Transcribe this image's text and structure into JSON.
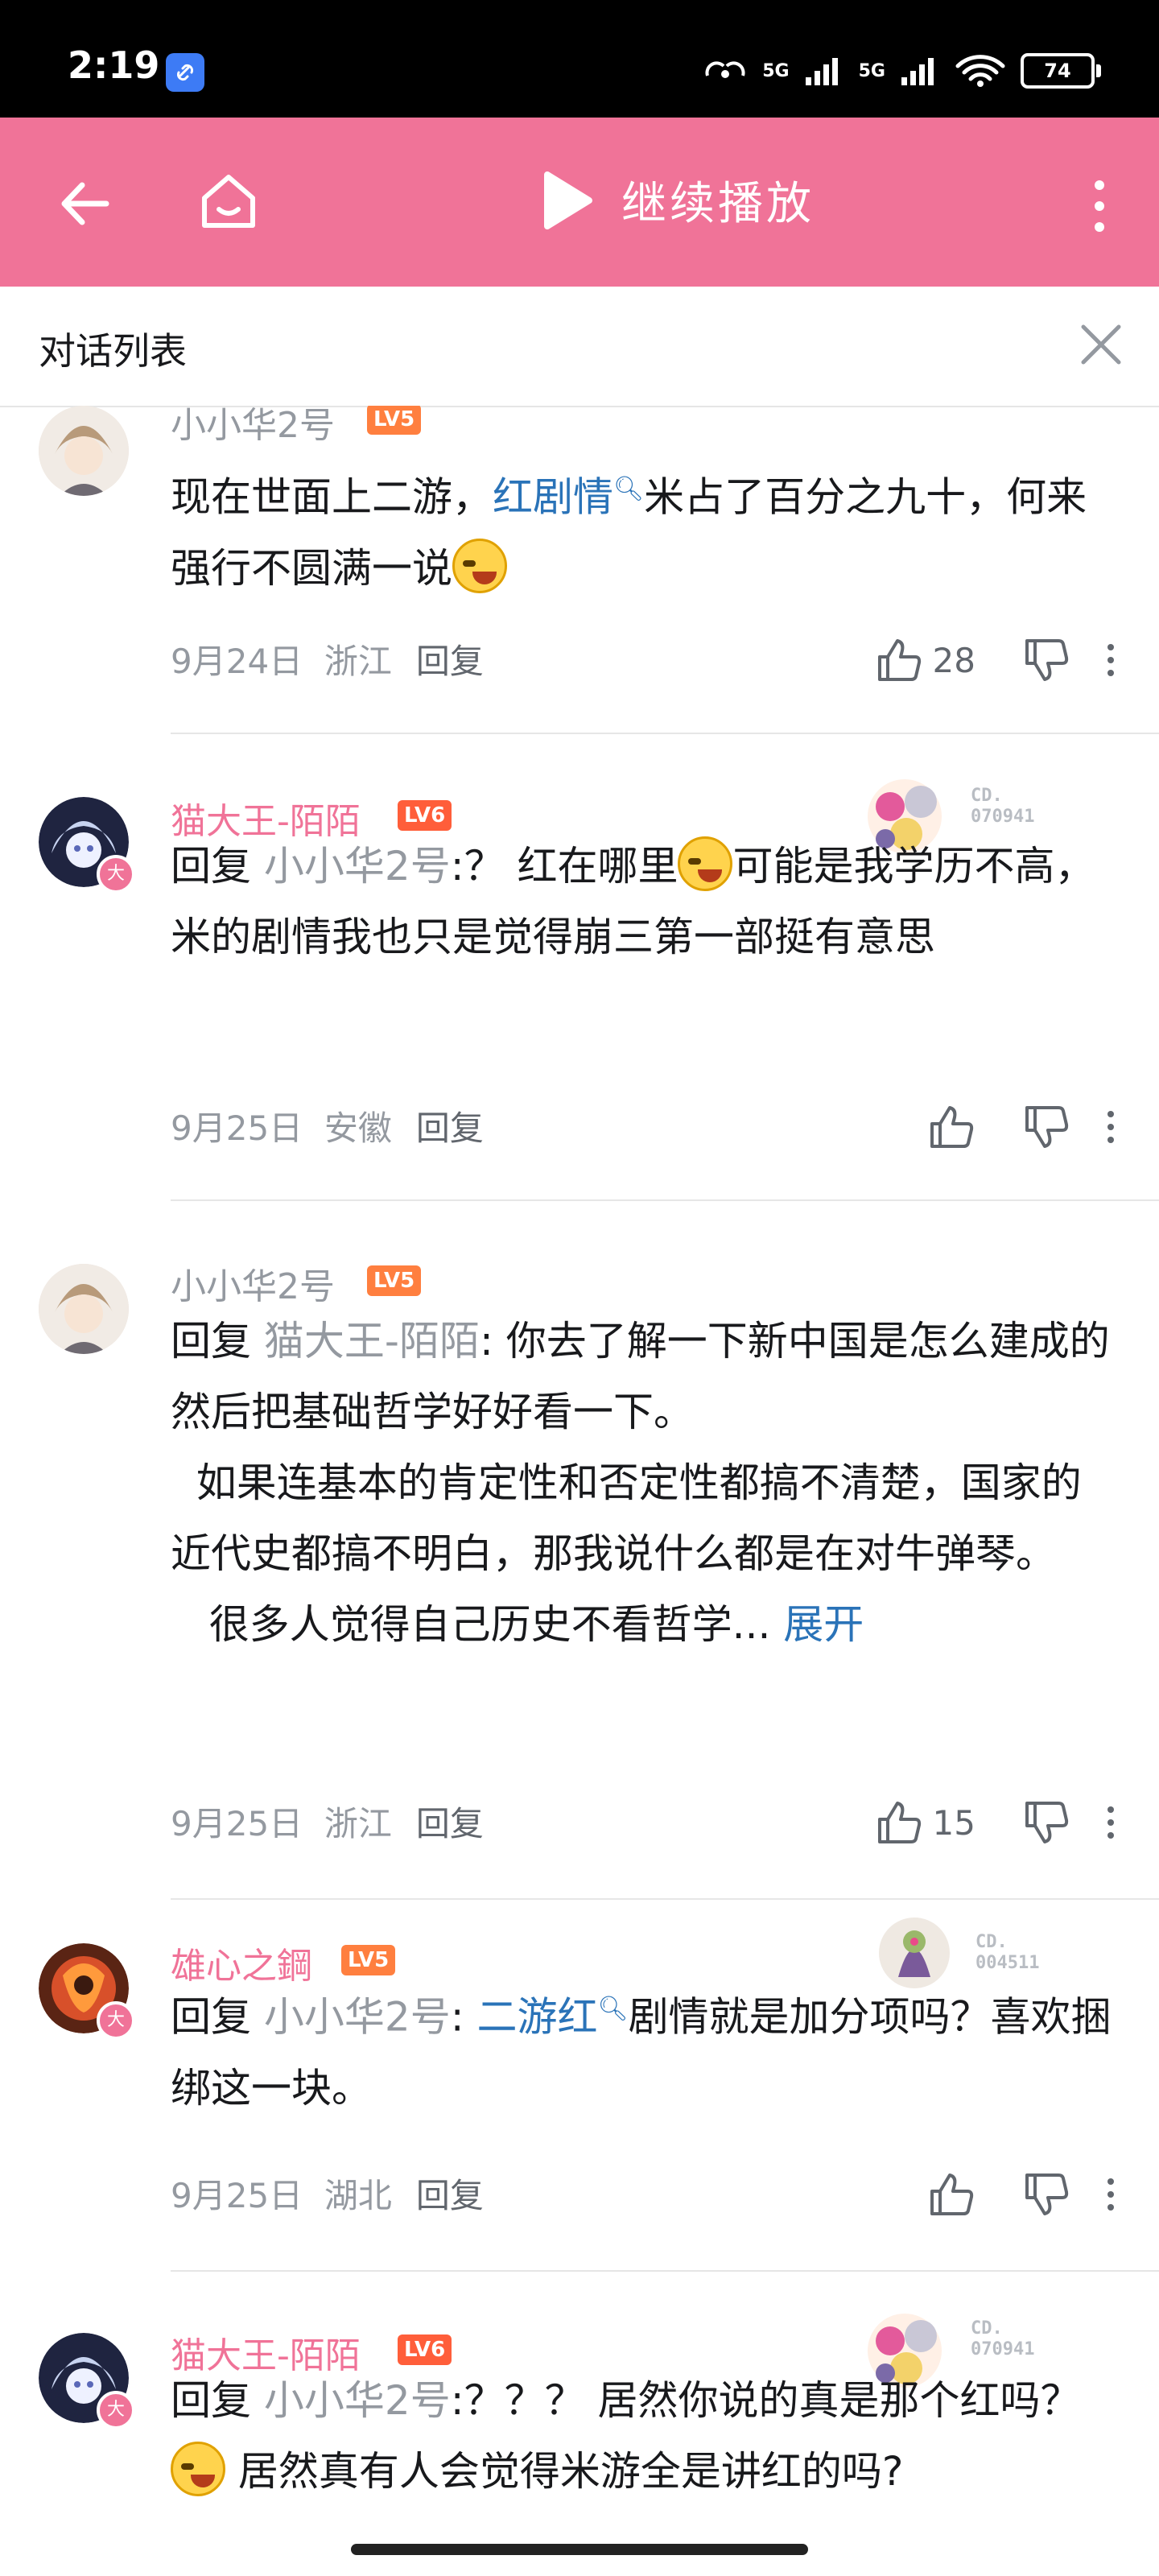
{
  "status_bar": {
    "time": "2:19",
    "net1": "5G",
    "net2": "5G",
    "battery": "74"
  },
  "top_bar": {
    "play_label": "继续播放"
  },
  "panel": {
    "title": "对话列表"
  },
  "comments": [
    {
      "user": "小小华2号",
      "level": "LV5",
      "t1": "现在世面上二游，",
      "link": "红剧情",
      "t2": "米占了百分之九十，何来强行不圆满一说",
      "date": "9月24日",
      "region": "浙江",
      "reply": "回复",
      "likes": "28"
    },
    {
      "user": "猫大王-陌陌",
      "level": "LV6",
      "fan_code_1": "CD.",
      "fan_code_2": "070941",
      "reply_prefix": "回复 ",
      "reply_to": "小小华2号",
      "t1": ":？ 红在哪里",
      "t2": "可能是我学历不高，米的剧情我也只是觉得崩三第一部挺有意思",
      "date": "9月25日",
      "region": "安徽",
      "reply": "回复"
    },
    {
      "user": "小小华2号",
      "level": "LV5",
      "reply_prefix": "回复 ",
      "reply_to": "猫大王-陌陌",
      "t1": ": 你去了解一下新中国是怎么建成的然后把基础哲学好好看一下。",
      "t2": "  如果连基本的肯定性和否定性都搞不清楚，国家的近代史都搞不明白，那我说什么都是在对牛弹琴。",
      "t3": "   很多人觉得自己历史不看哲学...",
      "expand": "展开",
      "date": "9月25日",
      "region": "浙江",
      "reply": "回复",
      "likes": "15"
    },
    {
      "user": "雄心之鋼",
      "level": "LV5",
      "fan_code_1": "CD.",
      "fan_code_2": "004511",
      "reply_prefix": "回复 ",
      "reply_to": "小小华2号",
      "colon": ": ",
      "link": "二游红",
      "t2": "剧情就是加分项吗？喜欢捆绑这一块。",
      "date": "9月25日",
      "region": "湖北",
      "reply": "回复"
    },
    {
      "user": "猫大王-陌陌",
      "level": "LV6",
      "fan_code_1": "CD.",
      "fan_code_2": "070941",
      "reply_prefix": "回复 ",
      "reply_to": "小小华2号",
      "t1": ":？？？ 居然你说的真是那个红吗？",
      "t2": "居然真有人会觉得米游全是讲红的吗?"
    }
  ],
  "avatar_badge": "大",
  "colors": {
    "accent": "#f07398",
    "link": "#2a73b8",
    "meta": "#9499a0"
  }
}
